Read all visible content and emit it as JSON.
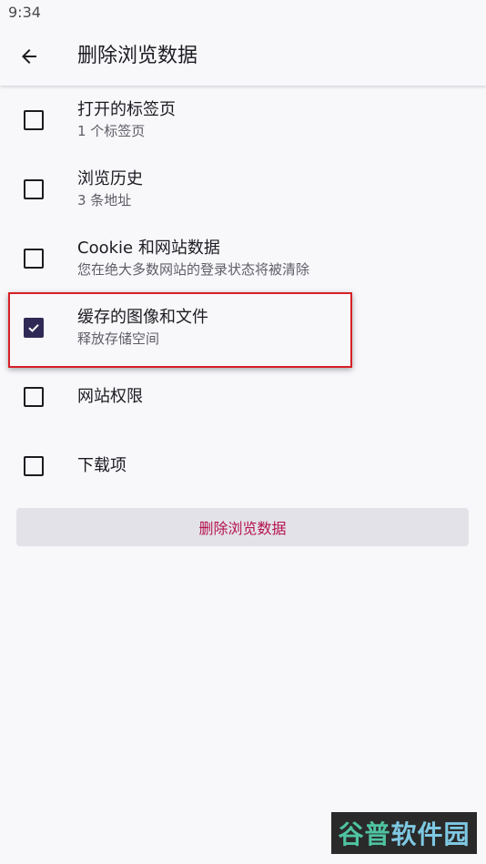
{
  "status_bar": {
    "time": "9:34"
  },
  "app_bar": {
    "title": "删除浏览数据",
    "back_icon": "arrow-back-icon"
  },
  "options": [
    {
      "title": "打开的标签页",
      "subtitle": "1 个标签页",
      "checked": false
    },
    {
      "title": "浏览历史",
      "subtitle": "3 条地址",
      "checked": false
    },
    {
      "title": "Cookie 和网站数据",
      "subtitle": "您在绝大多数网站的登录状态将被清除",
      "checked": false
    },
    {
      "title": "缓存的图像和文件",
      "subtitle": "释放存储空间",
      "checked": true
    },
    {
      "title": "网站权限",
      "subtitle": "",
      "checked": false
    },
    {
      "title": "下载项",
      "subtitle": "",
      "checked": false
    }
  ],
  "delete_button": {
    "label": "删除浏览数据"
  },
  "watermark": {
    "part1": "谷普",
    "part2": "软件园"
  },
  "colors": {
    "accent": "#2f2a55",
    "delete_text": "#b5124f",
    "highlight": "#d81f26"
  }
}
